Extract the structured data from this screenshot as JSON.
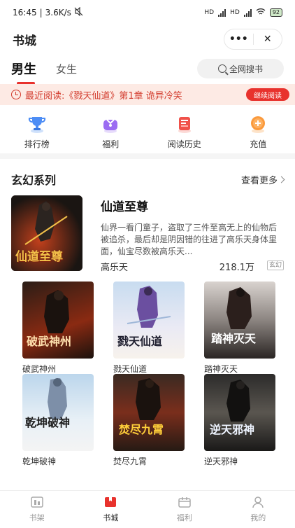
{
  "status_bar": {
    "time": "16:45",
    "speed": "3.6K/s",
    "battery": "92",
    "network": "HD"
  },
  "header": {
    "title": "书城",
    "more_label": "•••",
    "close_label": "✕"
  },
  "tabs": [
    {
      "label": "男生",
      "active": true
    },
    {
      "label": "女生",
      "active": false
    }
  ],
  "search": {
    "label": "全网搜书",
    "icon": "search-icon"
  },
  "recent": {
    "text": "最近阅读:《戮天仙道》第1章 诡异冷笑",
    "button": "继续阅读",
    "icon": "clock-icon"
  },
  "quick_nav": [
    {
      "label": "排行榜",
      "icon": "trophy-icon"
    },
    {
      "label": "福利",
      "icon": "gift-icon"
    },
    {
      "label": "阅读历史",
      "icon": "history-icon"
    },
    {
      "label": "充值",
      "icon": "coin-icon"
    }
  ],
  "section": {
    "title": "玄幻系列",
    "more": "查看更多"
  },
  "featured": {
    "title": "仙道至尊",
    "cover_text": "仙道至尊",
    "description": "仙界一看门童子，盗取了三件至高无上的仙物后被追杀，最后却是阴因错的往进了高乐天身体里面，仙宝尽数被高乐天...",
    "author": "高乐天",
    "count": "218.1万",
    "tag": "玄幻"
  },
  "books": [
    {
      "title": "破武神州",
      "cover_text": "破武神州"
    },
    {
      "title": "戮天仙道",
      "cover_text": "戮天仙道"
    },
    {
      "title": "踏神灭天",
      "cover_text": "踏神灭天"
    },
    {
      "title": "乾坤破神",
      "cover_text": "乾坤破神"
    },
    {
      "title": "焚尽九霄",
      "cover_text": "焚尽九霄"
    },
    {
      "title": "逆天邪神",
      "cover_text": "逆天邪神"
    }
  ],
  "tabbar": [
    {
      "label": "书架",
      "active": false,
      "icon": "bookshelf-icon"
    },
    {
      "label": "书城",
      "active": true,
      "icon": "bookstore-icon"
    },
    {
      "label": "福利",
      "active": false,
      "icon": "welfare-icon"
    },
    {
      "label": "我的",
      "active": false,
      "icon": "profile-icon"
    }
  ],
  "colors": {
    "accent": "#e8322d",
    "banner_bg": "#fdeae4"
  }
}
